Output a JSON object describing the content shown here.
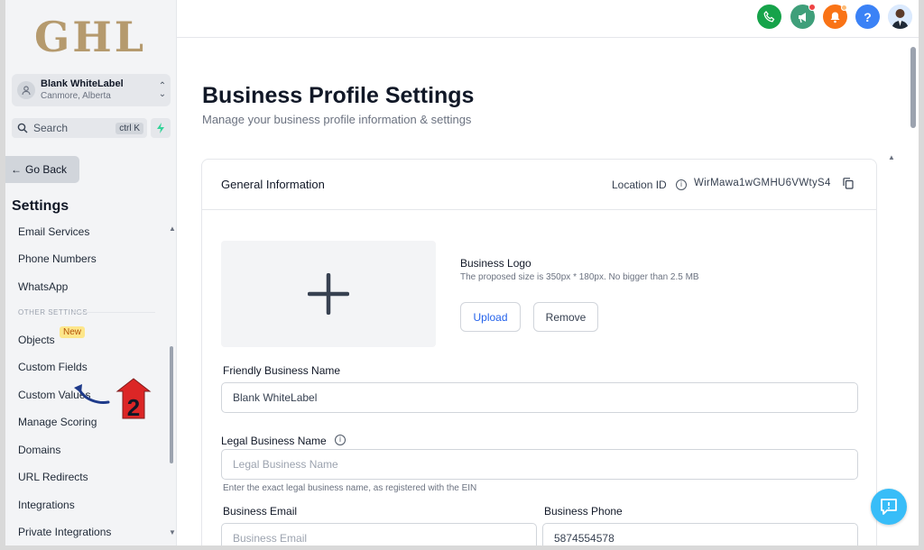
{
  "colors": {
    "accent": "#2563eb",
    "phone": "#16a34a",
    "marketing": "#38a169",
    "notifications": "#f97316",
    "help": "#3b82f6",
    "chat": "#38bdf8",
    "logo": "#b59a6e",
    "annotation_red": "#dc2626",
    "annotation_arrow": "#1e3a8a"
  },
  "sidebar": {
    "logo_text": "GHL",
    "account": {
      "name": "Blank WhiteLabel",
      "location": "Canmore, Alberta"
    },
    "search": {
      "label": "Search",
      "shortcut": "ctrl K"
    },
    "go_back": "Go Back",
    "settings_title": "Settings",
    "items": [
      {
        "label": "Email Services"
      },
      {
        "label": "Phone Numbers"
      },
      {
        "label": "WhatsApp"
      },
      {
        "label": "Objects",
        "badge": "New"
      },
      {
        "label": "Custom Fields"
      },
      {
        "label": "Custom Values"
      },
      {
        "label": "Manage Scoring"
      },
      {
        "label": "Domains"
      },
      {
        "label": "URL Redirects"
      },
      {
        "label": "Integrations"
      },
      {
        "label": "Private Integrations"
      }
    ],
    "section_label": "OTHER SETTINGS"
  },
  "topbar": {
    "icons": [
      "phone-icon",
      "megaphone-icon",
      "bell-icon",
      "help-icon",
      "user-avatar"
    ],
    "help_label": "?"
  },
  "main": {
    "title": "Business Profile Settings",
    "subtitle": "Manage your business profile information & settings",
    "card": {
      "title": "General Information",
      "location_label": "Location ID",
      "location_id": "WirMawa1wGMHU6VWtyS4",
      "logo_label": "Business Logo",
      "logo_hint": "The proposed size is 350px * 180px. No bigger than 2.5 MB",
      "upload_label": "Upload",
      "remove_label": "Remove",
      "friendly_name_label": "Friendly Business Name",
      "friendly_name_value": "Blank WhiteLabel",
      "legal_name_label": "Legal Business Name",
      "legal_name_placeholder": "Legal Business Name",
      "legal_name_helper": "Enter the exact legal business name, as registered with the EIN",
      "email_label": "Business Email",
      "email_placeholder": "Business Email",
      "phone_label": "Business Phone",
      "phone_value": "5874554578"
    }
  },
  "annotation": {
    "step_number": "2"
  }
}
